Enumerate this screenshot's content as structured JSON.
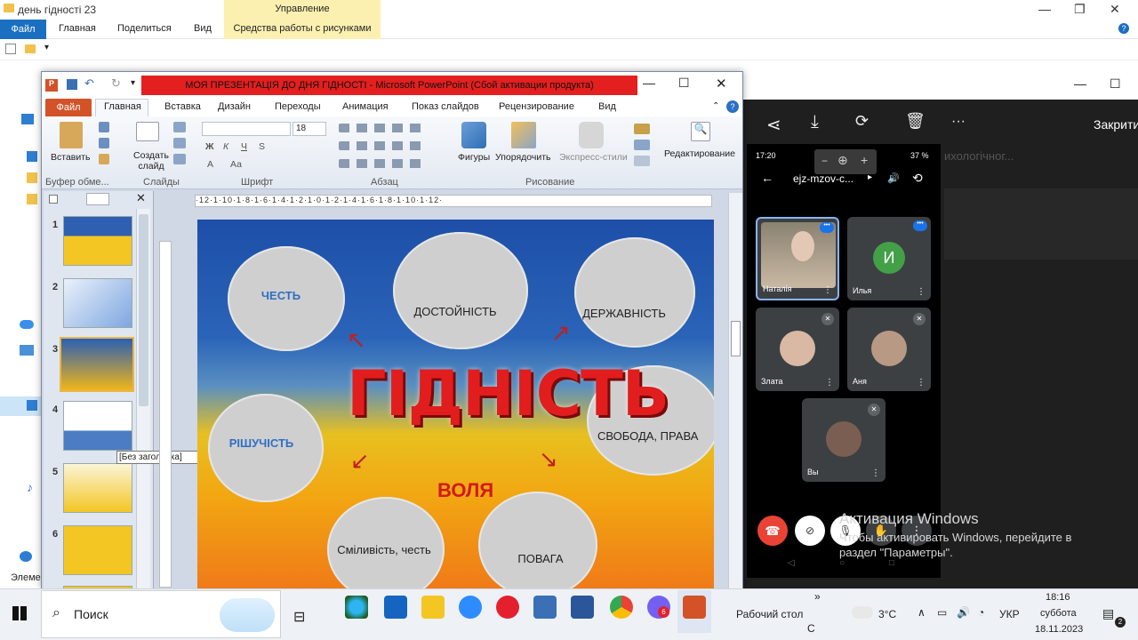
{
  "explorer": {
    "title": "день гідності 23",
    "tabs": [
      "Файл",
      "Главная",
      "Поделиться",
      "Вид"
    ],
    "manage_top": "Управление",
    "manage_bottom": "Средства работы с рисунками",
    "status_left": "Элеме"
  },
  "ppt": {
    "title": "МОЯ ПРЕЗЕНТАЦІЯ ДО ДНЯ ГІДНОСТІ - Microsoft PowerPoint (Сбой активации продукта)",
    "tabs": [
      "Файл",
      "Главная",
      "Вставка",
      "Дизайн",
      "Переходы",
      "Анимация",
      "Показ слайдов",
      "Рецензирование",
      "Вид"
    ],
    "ribbon": {
      "paste": "Вставить",
      "new_slide": "Создать слайд",
      "shapes": "Фигуры",
      "arrange": "Упорядочить",
      "quick_styles": "Экспресс-стили",
      "editing": "Редактирование",
      "font_size": "18",
      "groups": [
        "Буфер обме...",
        "Слайды",
        "Шрифт",
        "Абзац",
        "Рисование"
      ]
    },
    "thumbnails": [
      "1",
      "2",
      "3",
      "4",
      "5",
      "6"
    ],
    "tooltip": "[Без заголовка]",
    "ruler": "·12·1·10·1·8·1·6·1·4·1·2·1·0·1·2·1·4·1·6·1·8·1·10·1·12·"
  },
  "slide": {
    "title": "ГІДНІСТЬ",
    "volya": "ВОЛЯ",
    "clouds": [
      "ЧЕСТЬ",
      "ДОСТОЙНІСТЬ",
      "ДЕРЖАВНІСТЬ",
      "РІШУЧІСТЬ",
      "СВОБОДА, ПРАВА",
      "Сміливість, честь",
      "ПОВАГА"
    ]
  },
  "meet_toolbar": {
    "close_label": "Закрити",
    "bg_text": "ихологічног..."
  },
  "phone": {
    "time": "17:20",
    "battery": "37 %",
    "meeting_code": "ejz-mzov-c...",
    "participants": [
      {
        "name": "Наталія",
        "initial": ""
      },
      {
        "name": "Илья",
        "initial": "И"
      },
      {
        "name": "Злата",
        "initial": ""
      },
      {
        "name": "Аня",
        "initial": ""
      },
      {
        "name": "Вы",
        "initial": ""
      }
    ]
  },
  "activation": {
    "title": "Активация Windows",
    "line1": "Чтобы активировать Windows, перейдите в",
    "line2": "раздел \"Параметры\"."
  },
  "taskbar": {
    "search": "Поиск",
    "desktop": "Рабочий стол",
    "weather": "3°C",
    "lang": "УКР",
    "time": "18:16",
    "day": "суббота",
    "date": "18.11.2023",
    "notif_count": "2",
    "viber_badge": "6",
    "desktop_sub": "С"
  }
}
